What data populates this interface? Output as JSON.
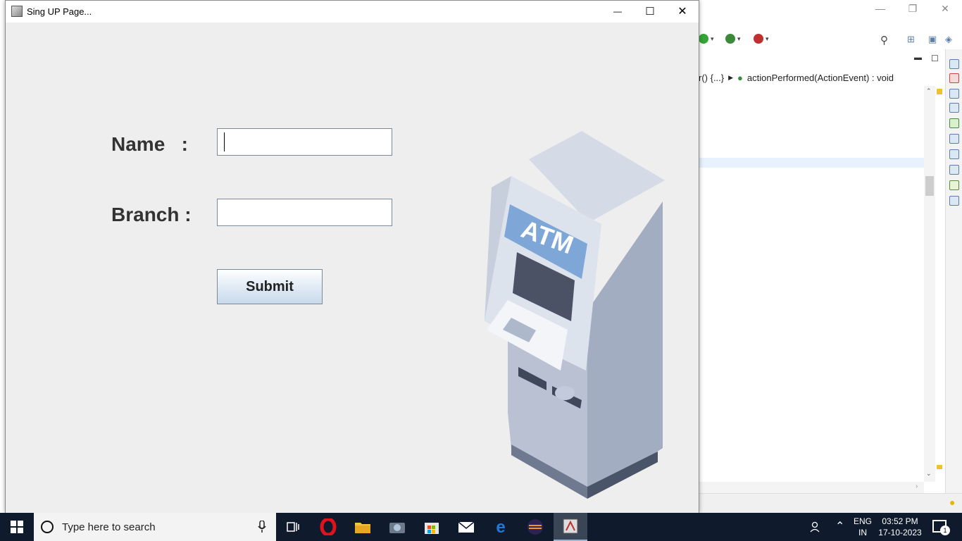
{
  "window": {
    "title": "Sing UP Page...",
    "minimize_glyph": "—",
    "maximize_glyph": "☐",
    "close_glyph": "✕"
  },
  "form": {
    "name_label": "Name   :",
    "branch_label": "Branch :",
    "name_value": "",
    "branch_value": "",
    "submit_label": "Submit"
  },
  "illustration": {
    "atm_text": "ATM"
  },
  "ide": {
    "breadcrumb_part1": "r() {...}",
    "breadcrumb_part2": "actionPerformed(ActionEvent) : void"
  },
  "taskbar": {
    "search_placeholder": "Type here to search",
    "apps": [
      "task-view-icon",
      "opera-icon",
      "file-explorer-icon",
      "camera-icon",
      "store-icon",
      "mail-icon",
      "edge-icon",
      "eclipse-icon",
      "java-app-icon"
    ],
    "language": "ENG",
    "region": "IN",
    "time": "03:52 PM",
    "date": "17-10-2023",
    "notification_count": "1"
  },
  "colors": {
    "frame_bg": "#eeeeee",
    "taskbar_bg": "#0f1b2d",
    "atm_banner": "#7ea7d8",
    "atm_body": "#a2adc2"
  }
}
